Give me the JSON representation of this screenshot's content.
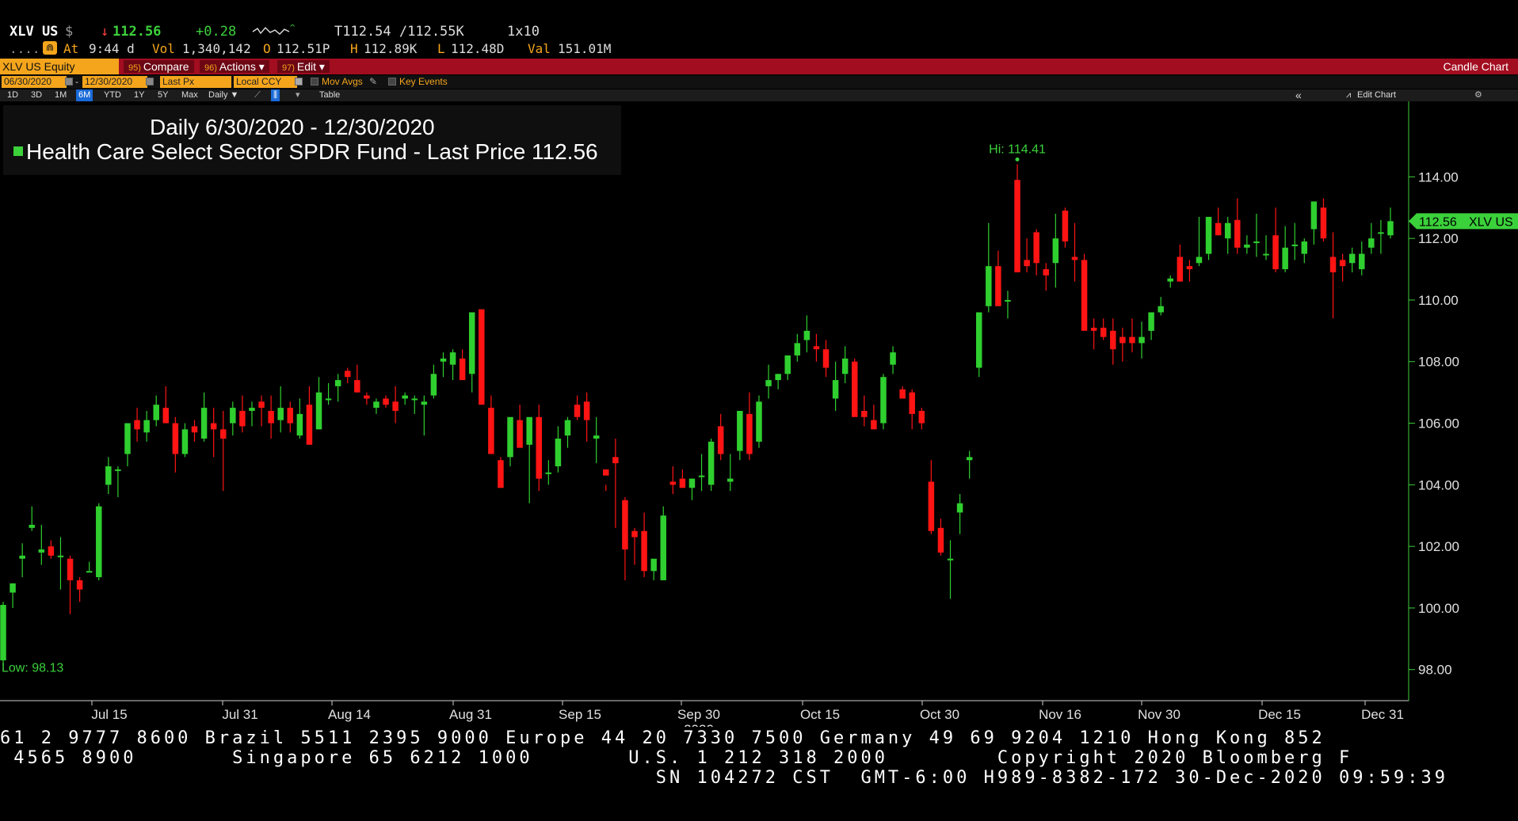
{
  "header": {
    "ticker": "XLV US",
    "currency": "$",
    "last_arrow": "↓",
    "last_price": "112.56",
    "change": "+0.28",
    "bid_ask": "T112.54 /112.55K",
    "size": "1x10",
    "dots": "....",
    "at_label": "At",
    "time": "9:44 d",
    "vol_label": "Vol",
    "volume": "1,340,142",
    "open_label": "O",
    "open": "112.51P",
    "high_label": "H",
    "high": "112.89K",
    "low_label": "L",
    "low": "112.48D",
    "val_label": "Val",
    "value": "151.01M"
  },
  "toolbar": {
    "security": "XLV US Equity",
    "compare_num": "95)",
    "compare_label": "Compare",
    "actions_num": "96)",
    "actions_label": "Actions ▾",
    "edit_num": "97)",
    "edit_label": "Edit ▾",
    "chart_type": "Candle Chart"
  },
  "datebar": {
    "start_date": "06/30/2020",
    "end_date": "12/30/2020",
    "field": "Last Px",
    "currency": "Local CCY",
    "mov_avgs": "Mov Avgs",
    "key_events": "Key Events"
  },
  "rangebar": {
    "ranges": [
      "1D",
      "3D",
      "1M",
      "6M",
      "YTD",
      "1Y",
      "5Y",
      "Max"
    ],
    "active_range": "6M",
    "frequency": "Daily ▼",
    "table_label": "Table",
    "collapse": "«",
    "edit_chart": "Edit Chart"
  },
  "legend": {
    "title": "Daily 6/30/2020 - 12/30/2020",
    "series_name": "Health Care Select Sector SPDR Fund - Last Price",
    "series_value": "112.56"
  },
  "colors": {
    "up": "#2fcf2f",
    "down": "#ff1414",
    "axis": "#3bd13b",
    "toolbar_red": "#a20d1f",
    "amber": "#f4a51c"
  },
  "chart_data": {
    "type": "candlestick",
    "ylim": [
      96.6,
      116.6
    ],
    "yticks": [
      "114.00",
      "112.00",
      "110.00",
      "108.00",
      "106.00",
      "104.00",
      "102.00",
      "100.00",
      "98.00"
    ],
    "xticks": [
      "Jul 15",
      "Jul 31",
      "Aug 14",
      "Aug 31",
      "Sep 15",
      "Sep 30",
      "Oct 15",
      "Oct 30",
      "Nov 16",
      "Nov 30",
      "Dec 15",
      "Dec 31"
    ],
    "x_year_label": "2020",
    "hi_label": "Hi: 114.41",
    "low_label": "Low: 98.13",
    "last_label": "112.56",
    "last_series": "XLV US",
    "candles": [
      [
        98.3,
        100.2,
        98.13,
        100.1
      ],
      [
        100.5,
        100.8,
        100.0,
        100.8
      ],
      [
        101.6,
        102.1,
        101.0,
        101.7
      ],
      [
        102.6,
        103.3,
        102.5,
        102.7
      ],
      [
        101.8,
        102.7,
        101.4,
        101.9
      ],
      [
        102.0,
        102.2,
        101.6,
        101.7
      ],
      [
        101.7,
        102.3,
        100.6,
        101.7
      ],
      [
        101.6,
        101.7,
        99.8,
        100.9
      ],
      [
        100.9,
        101.0,
        100.2,
        100.6
      ],
      [
        101.2,
        101.5,
        101.2,
        101.2
      ],
      [
        101.0,
        103.4,
        100.9,
        103.3
      ],
      [
        104.0,
        104.9,
        103.7,
        104.6
      ],
      [
        104.5,
        104.6,
        103.6,
        104.5
      ],
      [
        105.0,
        106.0,
        104.6,
        106.0
      ],
      [
        106.1,
        106.5,
        105.4,
        105.8
      ],
      [
        105.7,
        106.4,
        105.4,
        106.1
      ],
      [
        106.1,
        106.9,
        105.9,
        106.6
      ],
      [
        106.5,
        107.2,
        106.3,
        106.0
      ],
      [
        106.0,
        106.2,
        104.4,
        105.0
      ],
      [
        105.0,
        106.0,
        104.9,
        105.8
      ],
      [
        105.9,
        106.1,
        105.4,
        105.7
      ],
      [
        105.5,
        107.0,
        105.4,
        106.5
      ],
      [
        106.0,
        106.5,
        104.9,
        105.8
      ],
      [
        105.8,
        106.4,
        103.8,
        105.5
      ],
      [
        106.0,
        106.7,
        105.6,
        106.5
      ],
      [
        106.4,
        106.9,
        105.7,
        105.9
      ],
      [
        106.4,
        106.7,
        105.9,
        106.5
      ],
      [
        106.7,
        106.9,
        105.9,
        106.5
      ],
      [
        106.4,
        106.9,
        105.5,
        106.0
      ],
      [
        106.1,
        107.2,
        105.7,
        106.5
      ],
      [
        106.5,
        106.7,
        105.7,
        106.0
      ],
      [
        105.6,
        106.8,
        105.5,
        106.3
      ],
      [
        106.6,
        107.2,
        105.4,
        105.3
      ],
      [
        105.8,
        107.5,
        105.8,
        107.0
      ],
      [
        106.8,
        107.3,
        106.6,
        106.8
      ],
      [
        107.2,
        107.6,
        106.7,
        107.4
      ],
      [
        107.7,
        107.8,
        107.3,
        107.5
      ],
      [
        107.4,
        107.9,
        107.0,
        107.0
      ],
      [
        106.9,
        107.0,
        106.6,
        106.8
      ],
      [
        106.5,
        106.8,
        106.3,
        106.7
      ],
      [
        106.8,
        106.9,
        106.5,
        106.6
      ],
      [
        106.7,
        107.2,
        106.0,
        106.4
      ],
      [
        106.8,
        107.0,
        106.6,
        106.9
      ],
      [
        106.8,
        106.9,
        106.3,
        106.8
      ],
      [
        106.6,
        106.9,
        105.6,
        106.7
      ],
      [
        106.9,
        107.9,
        106.8,
        107.6
      ],
      [
        108.0,
        108.3,
        107.5,
        108.1
      ],
      [
        107.9,
        108.4,
        107.4,
        108.3
      ],
      [
        108.1,
        108.4,
        107.6,
        107.4
      ],
      [
        107.6,
        109.6,
        107.0,
        109.6
      ],
      [
        109.7,
        109.7,
        108.9,
        106.6
      ],
      [
        106.5,
        106.9,
        105.0,
        105.0
      ],
      [
        104.8,
        104.9,
        103.9,
        103.9
      ],
      [
        104.9,
        106.0,
        104.6,
        106.2
      ],
      [
        106.1,
        106.6,
        105.7,
        105.2
      ],
      [
        105.3,
        105.4,
        103.4,
        106.2
      ],
      [
        106.2,
        106.6,
        103.8,
        104.2
      ],
      [
        104.4,
        104.8,
        104.0,
        104.4
      ],
      [
        104.6,
        105.9,
        104.4,
        105.5
      ],
      [
        105.6,
        106.2,
        105.2,
        106.1
      ],
      [
        106.6,
        106.9,
        106.1,
        106.2
      ],
      [
        106.7,
        107.0,
        105.4,
        106.1
      ],
      [
        105.5,
        106.2,
        104.7,
        105.6
      ],
      [
        104.5,
        104.0,
        103.8,
        104.3
      ],
      [
        104.9,
        105.5,
        102.6,
        104.7
      ],
      [
        103.5,
        103.6,
        100.9,
        101.9
      ],
      [
        102.5,
        102.6,
        101.4,
        102.3
      ],
      [
        102.5,
        103.1,
        101.0,
        101.2
      ],
      [
        101.2,
        101.4,
        100.9,
        101.6
      ],
      [
        100.9,
        103.3,
        100.9,
        103.0
      ],
      [
        104.1,
        104.6,
        103.7,
        104.0
      ],
      [
        104.2,
        104.5,
        103.9,
        103.9
      ],
      [
        103.9,
        104.2,
        103.5,
        104.2
      ],
      [
        104.3,
        105.0,
        103.8,
        104.3
      ],
      [
        104.0,
        105.5,
        103.8,
        105.4
      ],
      [
        105.9,
        106.3,
        104.8,
        105.0
      ],
      [
        104.1,
        105.0,
        103.8,
        104.2
      ],
      [
        105.1,
        106.0,
        104.8,
        106.4
      ],
      [
        106.3,
        107.0,
        104.8,
        105.0
      ],
      [
        105.4,
        106.9,
        105.2,
        106.7
      ],
      [
        107.2,
        107.9,
        106.8,
        107.4
      ],
      [
        107.4,
        107.6,
        107.1,
        107.6
      ],
      [
        107.6,
        108.1,
        107.4,
        108.2
      ],
      [
        108.2,
        108.9,
        108.0,
        108.6
      ],
      [
        108.7,
        109.5,
        108.3,
        109.0
      ],
      [
        108.5,
        108.9,
        108.0,
        108.4
      ],
      [
        108.4,
        108.7,
        107.5,
        107.8
      ],
      [
        106.8,
        108.0,
        106.4,
        107.4
      ],
      [
        107.6,
        108.5,
        107.3,
        108.1
      ],
      [
        108.0,
        108.1,
        106.3,
        106.2
      ],
      [
        106.4,
        106.9,
        105.9,
        106.2
      ],
      [
        106.1,
        106.6,
        105.9,
        105.8
      ],
      [
        106.0,
        107.6,
        105.8,
        107.5
      ],
      [
        107.9,
        108.5,
        107.6,
        108.3
      ],
      [
        107.1,
        107.2,
        106.9,
        106.8
      ],
      [
        107.0,
        107.1,
        105.8,
        106.3
      ],
      [
        106.4,
        106.5,
        105.8,
        106.0
      ],
      [
        104.1,
        104.8,
        102.4,
        102.5
      ],
      [
        102.6,
        102.9,
        101.7,
        101.8
      ],
      [
        101.6,
        102.2,
        100.3,
        101.6
      ],
      [
        103.1,
        103.7,
        102.4,
        103.4
      ],
      [
        104.8,
        105.1,
        104.2,
        104.9
      ],
      [
        107.8,
        108.0,
        107.5,
        109.6
      ],
      [
        109.8,
        112.5,
        109.6,
        111.1
      ],
      [
        111.1,
        111.6,
        109.9,
        109.8
      ],
      [
        110.0,
        110.3,
        109.4,
        110.0
      ],
      [
        113.9,
        114.41,
        110.9,
        110.9
      ],
      [
        111.3,
        112.0,
        110.9,
        111.1
      ],
      [
        112.2,
        112.3,
        110.8,
        111.2
      ],
      [
        111.0,
        111.2,
        110.3,
        110.8
      ],
      [
        111.2,
        112.8,
        110.4,
        112.0
      ],
      [
        112.9,
        113.0,
        111.7,
        111.9
      ],
      [
        111.4,
        112.5,
        110.6,
        111.3
      ],
      [
        111.3,
        111.5,
        109.1,
        109.0
      ],
      [
        109.1,
        109.4,
        108.4,
        109.0
      ],
      [
        109.1,
        109.4,
        108.7,
        108.8
      ],
      [
        109.0,
        109.4,
        107.9,
        108.4
      ],
      [
        108.8,
        109.1,
        108.0,
        108.6
      ],
      [
        108.8,
        109.4,
        108.3,
        108.6
      ],
      [
        108.6,
        109.3,
        108.1,
        108.8
      ],
      [
        109.0,
        109.5,
        108.7,
        109.6
      ],
      [
        109.6,
        110.1,
        109.5,
        109.8
      ],
      [
        110.6,
        110.8,
        110.4,
        110.7
      ],
      [
        111.4,
        111.8,
        110.6,
        110.6
      ],
      [
        111.1,
        111.3,
        110.6,
        111.0
      ],
      [
        111.2,
        112.7,
        111.1,
        111.4
      ],
      [
        111.5,
        112.4,
        111.3,
        112.7
      ],
      [
        112.5,
        113.0,
        112.3,
        112.1
      ],
      [
        112.0,
        112.7,
        111.5,
        112.5
      ],
      [
        112.6,
        113.3,
        111.5,
        111.7
      ],
      [
        111.7,
        112.1,
        111.5,
        111.8
      ],
      [
        111.9,
        112.8,
        111.4,
        111.9
      ],
      [
        111.5,
        112.1,
        111.3,
        111.5
      ],
      [
        112.1,
        113.0,
        110.9,
        111.0
      ],
      [
        111.0,
        112.4,
        110.9,
        111.7
      ],
      [
        111.8,
        112.5,
        111.3,
        111.8
      ],
      [
        111.5,
        112.0,
        111.2,
        111.9
      ],
      [
        112.3,
        113.1,
        111.8,
        113.2
      ],
      [
        113.0,
        113.3,
        111.9,
        112.0
      ],
      [
        111.4,
        112.2,
        109.4,
        110.9
      ],
      [
        111.3,
        111.5,
        110.6,
        111.1
      ],
      [
        111.2,
        111.7,
        110.9,
        111.5
      ],
      [
        111.0,
        111.9,
        110.8,
        111.5
      ],
      [
        111.7,
        112.5,
        111.5,
        112.0
      ],
      [
        112.2,
        112.6,
        111.5,
        112.2
      ],
      [
        112.1,
        113.0,
        112.0,
        112.56
      ]
    ]
  },
  "footer": {
    "line1": "61 2 9777 8600 Brazil 5511 2395 9000 Europe 44 20 7330 7500 Germany 49 69 9204 1210 Hong Kong 852",
    "line2": " 4565 8900       Singapore 65 6212 1000       U.S. 1 212 318 2000        Copyright 2020 Bloomberg F",
    "line3": "                                                SN 104272 CST  GMT-6:00 H989-8382-172 30-Dec-2020 09:59:39"
  }
}
